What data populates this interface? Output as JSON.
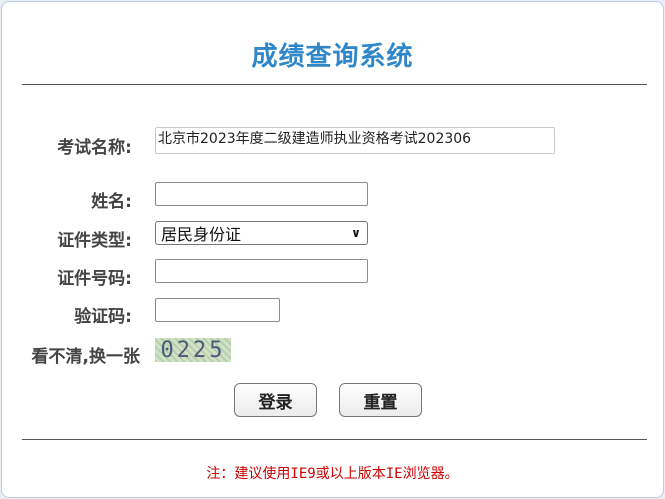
{
  "page": {
    "title": "成绩查询系统"
  },
  "form": {
    "exam_label": "考试名称:",
    "exam_value": "北京市2023年度二级建造师执业资格考试202306",
    "name_label": "姓名:",
    "name_value": "",
    "id_type_label": "证件类型:",
    "id_type_value": "居民身份证",
    "id_number_label": "证件号码:",
    "id_number_value": "",
    "captcha_label": "验证码:",
    "captcha_value": "",
    "refresh_label": "看不清,换一张",
    "captcha_text": "0225"
  },
  "buttons": {
    "login": "登录",
    "reset": "重置"
  },
  "footer": {
    "note": "注：建议使用IE9或以上版本IE浏览器。"
  },
  "colors": {
    "title": "#2f87c9",
    "note": "#cc0000",
    "label": "#444444"
  },
  "icons": {
    "select_arrow": "chevron-down-icon"
  }
}
